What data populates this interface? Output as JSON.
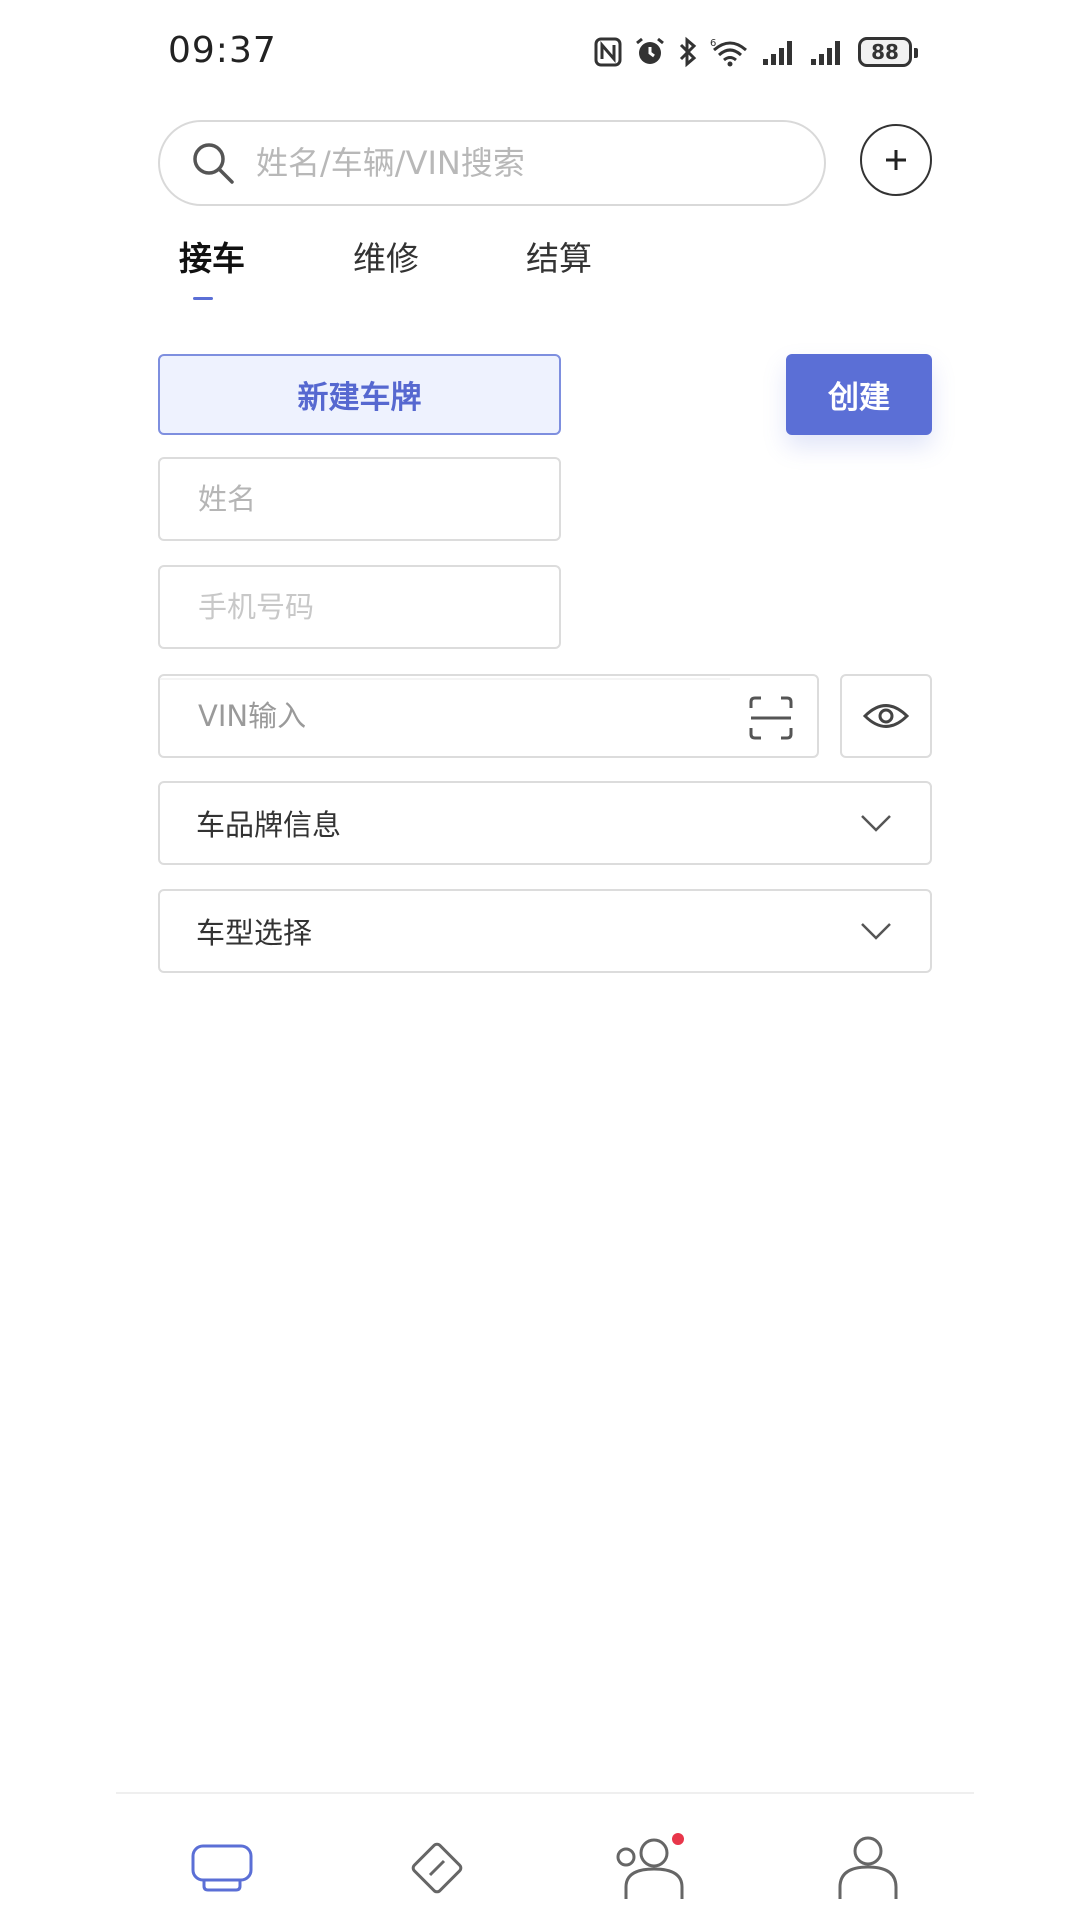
{
  "status_bar": {
    "time": "09:37",
    "battery": "88",
    "icons": [
      "nfc-icon",
      "alarm-icon",
      "bluetooth-icon",
      "wifi-icon",
      "signal-icon",
      "signal-icon"
    ]
  },
  "search": {
    "placeholder": "姓名/车辆/VIN搜索",
    "add_icon": "plus-icon"
  },
  "tabs": [
    {
      "label": "接车",
      "active": true
    },
    {
      "label": "维修",
      "active": false
    },
    {
      "label": "结算",
      "active": false
    }
  ],
  "form": {
    "new_plate_label": "新建车牌",
    "create_label": "创建",
    "name_placeholder": "姓名",
    "phone_placeholder": "手机号码",
    "vin_placeholder": "VIN输入",
    "brand_label": "车品牌信息",
    "model_label": "车型选择"
  },
  "bottom_nav": [
    {
      "icon": "car-icon",
      "active": true
    },
    {
      "icon": "repair-tag-icon",
      "active": false
    },
    {
      "icon": "customers-icon",
      "active": false,
      "badge": true
    },
    {
      "icon": "profile-icon",
      "active": false
    }
  ],
  "colors": {
    "accent": "#5b6fd6",
    "accent_light_bg": "#eef2fe",
    "badge": "#e8364a",
    "border": "#dcdcdc"
  }
}
